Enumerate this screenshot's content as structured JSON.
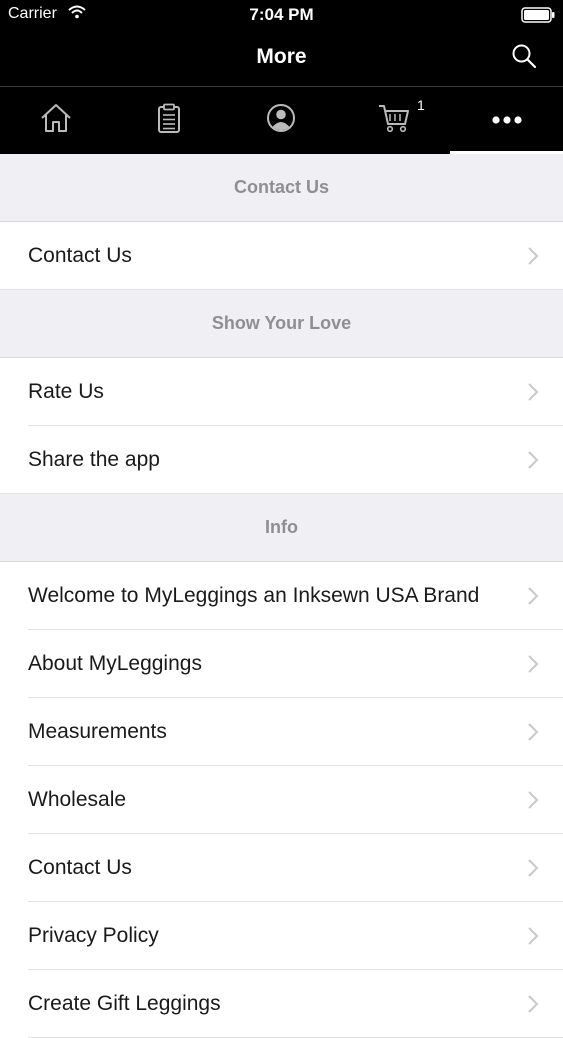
{
  "status_bar": {
    "carrier": "Carrier",
    "time": "7:04 PM"
  },
  "nav": {
    "title": "More"
  },
  "tabs": [
    {
      "icon": "home-icon"
    },
    {
      "icon": "clipboard-icon"
    },
    {
      "icon": "profile-icon"
    },
    {
      "icon": "cart-icon",
      "badge": "1"
    },
    {
      "icon": "more-dots-icon",
      "active": true
    }
  ],
  "sections": [
    {
      "header": "Contact Us",
      "items": [
        "Contact Us"
      ]
    },
    {
      "header": "Show Your Love",
      "items": [
        "Rate Us",
        "Share the app"
      ]
    },
    {
      "header": "Info",
      "items": [
        "Welcome to MyLeggings an Inksewn USA Brand",
        "About MyLeggings",
        "Measurements",
        "Wholesale",
        "Contact Us",
        "Privacy Policy",
        "Create Gift Leggings"
      ]
    }
  ],
  "colors": {
    "bar_background": "#000000",
    "section_background": "#efeff4",
    "section_text": "#8e8e93"
  }
}
